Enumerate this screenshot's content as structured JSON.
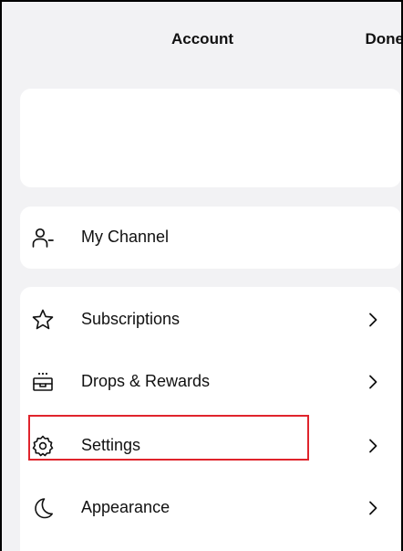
{
  "header": {
    "title": "Account",
    "done_label": "Done"
  },
  "channel_row": {
    "label": "My Channel",
    "icon": "person-dash-icon"
  },
  "menu": {
    "items": [
      {
        "label": "Subscriptions",
        "icon": "star-icon"
      },
      {
        "label": "Drops & Rewards",
        "icon": "gift-box-icon"
      },
      {
        "label": "Settings",
        "icon": "gear-icon"
      },
      {
        "label": "Appearance",
        "icon": "moon-icon"
      }
    ]
  },
  "colors": {
    "page_background": "#f2f2f4",
    "card_background": "#ffffff",
    "text": "#111111",
    "highlight": "#e0242c"
  }
}
